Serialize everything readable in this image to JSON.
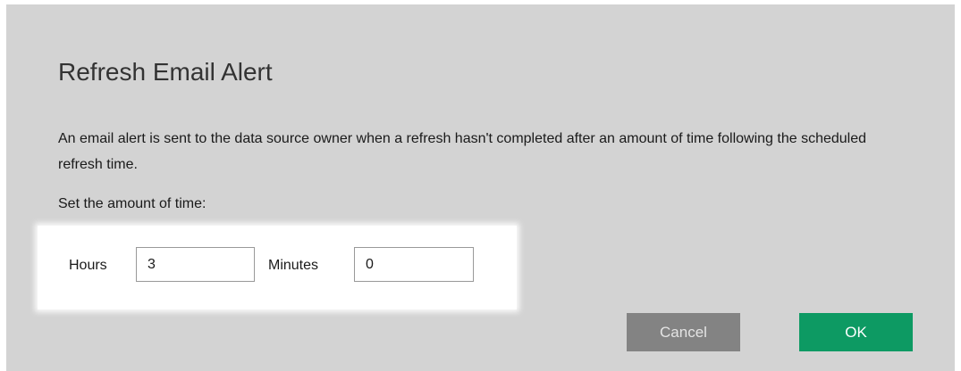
{
  "dialog": {
    "title": "Refresh Email Alert",
    "description": "An email alert is sent to the data source owner when a refresh hasn't completed after an amount of time following the scheduled refresh time.",
    "prompt": "Set the amount of time:",
    "hours": {
      "label": "Hours",
      "value": "3"
    },
    "minutes": {
      "label": "Minutes",
      "value": "0"
    },
    "buttons": {
      "cancel_label": "Cancel",
      "ok_label": "OK"
    }
  },
  "colors": {
    "dialog_background": "#d3d3d3",
    "cancel_button": "#838383",
    "ok_button": "#0d9a63"
  }
}
